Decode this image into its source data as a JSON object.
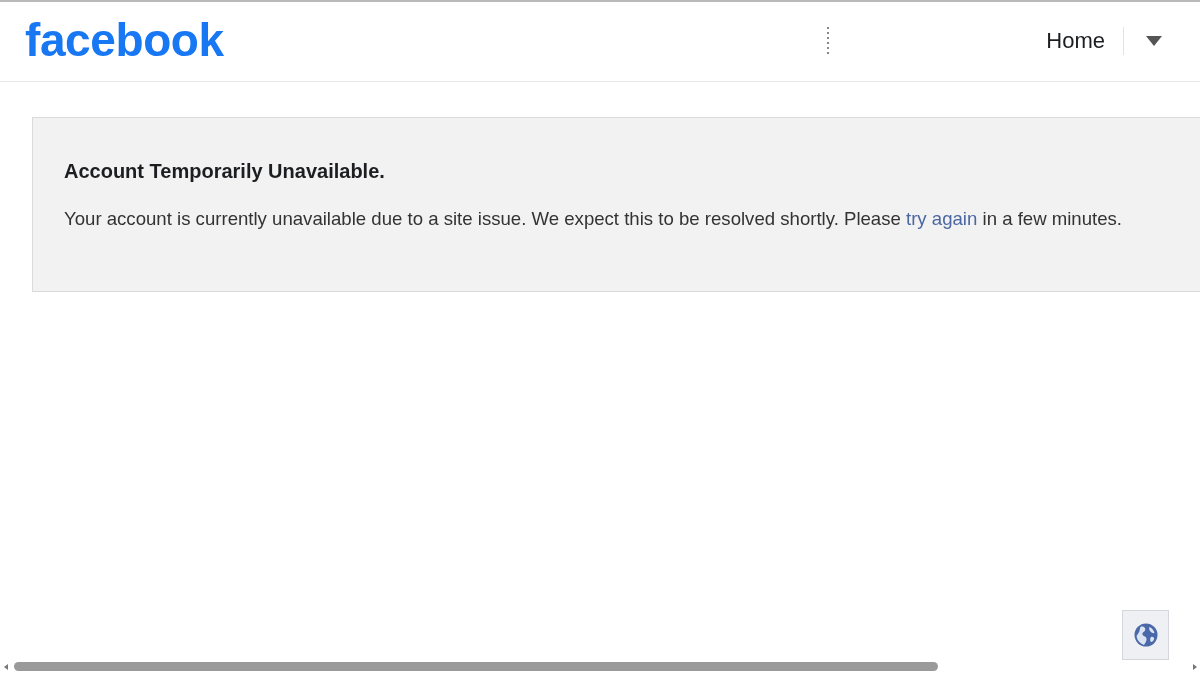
{
  "header": {
    "logo": "facebook",
    "nav": [
      {
        "label": "Home"
      }
    ]
  },
  "alert": {
    "title": "Account Temporarily Unavailable.",
    "message": {
      "before": "Your account is currently unavailable due to a site issue. We expect this to be resolved shortly. Please",
      "link": "try again",
      "after": "in a few minutes."
    }
  }
}
